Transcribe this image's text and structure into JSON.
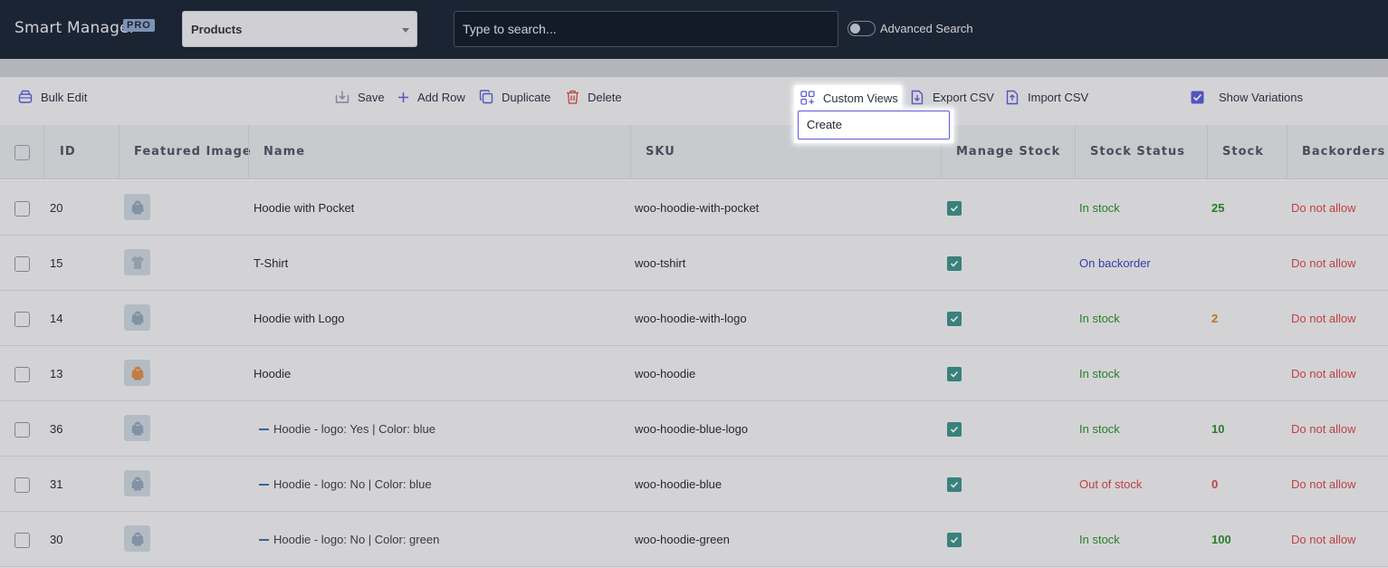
{
  "app": {
    "title": "Smart Manager",
    "badge": "PRO"
  },
  "dashboard": {
    "selected": "Products"
  },
  "search": {
    "placeholder": "Type to search...",
    "advanced_label": "Advanced Search",
    "advanced_enabled": false
  },
  "toolbar": {
    "bulk_edit": "Bulk Edit",
    "save": "Save",
    "add_row": "Add Row",
    "duplicate": "Duplicate",
    "delete": "Delete",
    "custom_views": "Custom Views",
    "export_csv": "Export CSV",
    "import_csv": "Import CSV",
    "show_variations": "Show Variations",
    "show_variations_checked": true
  },
  "custom_views_menu": {
    "items": [
      "Create"
    ]
  },
  "columns": [
    "ID",
    "Featured Image",
    "Name",
    "SKU",
    "Manage Stock",
    "Stock Status",
    "Stock",
    "Backorders"
  ],
  "rows": [
    {
      "id": "20",
      "name": "Hoodie with Pocket",
      "variation": false,
      "sku": "woo-hoodie-with-pocket",
      "manage_stock": true,
      "stock_status": "In stock",
      "status_color": "#2b8a2b",
      "stock": "25",
      "stock_color": "#2b8a2b",
      "backorders": "Do not allow",
      "image": "hoodie-thumbnail"
    },
    {
      "id": "15",
      "name": "T-Shirt",
      "variation": false,
      "sku": "woo-tshirt",
      "manage_stock": true,
      "stock_status": "On backorder",
      "status_color": "#3c3ec2",
      "stock": "",
      "stock_color": "#2b8a2b",
      "backorders": "Do not allow",
      "image": "tshirt-thumbnail"
    },
    {
      "id": "14",
      "name": "Hoodie with Logo",
      "variation": false,
      "sku": "woo-hoodie-with-logo",
      "manage_stock": true,
      "stock_status": "In stock",
      "status_color": "#2b8a2b",
      "stock": "2",
      "stock_color": "#d67a1f",
      "backorders": "Do not allow",
      "image": "hoodie-thumbnail"
    },
    {
      "id": "13",
      "name": "Hoodie",
      "variation": false,
      "sku": "woo-hoodie",
      "manage_stock": true,
      "stock_status": "In stock",
      "status_color": "#2b8a2b",
      "stock": "",
      "stock_color": "#2b8a2b",
      "backorders": "Do not allow",
      "image": "hoodie-orange-thumbnail"
    },
    {
      "id": "36",
      "name": "Hoodie - logo: Yes | Color: blue",
      "variation": true,
      "sku": "woo-hoodie-blue-logo",
      "manage_stock": true,
      "stock_status": "In stock",
      "status_color": "#2b8a2b",
      "stock": "10",
      "stock_color": "#2b8a2b",
      "backorders": "Do not allow",
      "image": "hoodie-thumbnail"
    },
    {
      "id": "31",
      "name": "Hoodie - logo: No | Color: blue",
      "variation": true,
      "sku": "woo-hoodie-blue",
      "manage_stock": true,
      "stock_status": "Out of stock",
      "status_color": "#d64646",
      "stock": "0",
      "stock_color": "#d64646",
      "backorders": "Do not allow",
      "image": "hoodie-thumbnail"
    },
    {
      "id": "30",
      "name": "Hoodie - logo: No | Color: green",
      "variation": true,
      "sku": "woo-hoodie-green",
      "manage_stock": true,
      "stock_status": "In stock",
      "status_color": "#2b8a2b",
      "stock": "100",
      "stock_color": "#2b8a2b",
      "backorders": "Do not allow",
      "image": "hoodie-thumbnail"
    }
  ],
  "colors": {
    "accent": "#5b5bd6",
    "topbar": "#1b2535",
    "backorders": "#d64646"
  }
}
